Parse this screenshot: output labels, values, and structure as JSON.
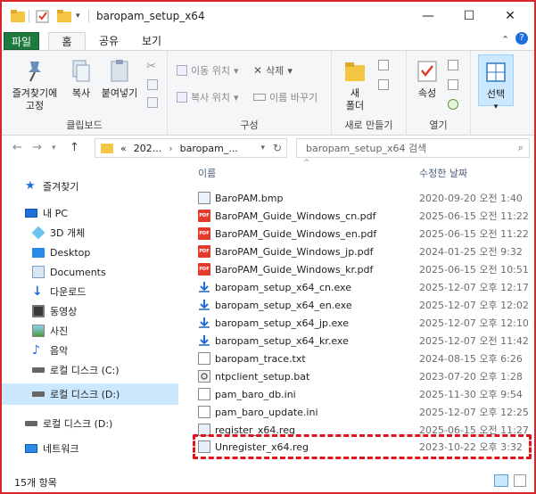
{
  "window": {
    "title": "baropam_setup_x64",
    "minimize_glyph": "—",
    "maximize_glyph": "☐",
    "close_glyph": "✕"
  },
  "ribbon_tabs": [
    "파일",
    "홈",
    "공유",
    "보기"
  ],
  "ribbon": {
    "clipboard": {
      "pin_label": "즐겨찾기에\n고정",
      "copy_label": "복사",
      "paste_label": "붙여넣기",
      "group_label": "클립보드"
    },
    "organize": {
      "move_to": "이동 위치",
      "copy_to": "복사 위치",
      "delete": "삭제",
      "rename": "이름 바꾸기",
      "group_label": "구성"
    },
    "new": {
      "new_folder": "새\n폴더",
      "group_label": "새로 만들기"
    },
    "open": {
      "properties": "속성",
      "group_label": "열기"
    },
    "select": {
      "select_label": "선택"
    }
  },
  "address_bar": {
    "prefix": "«",
    "crumb1": "202...",
    "crumb2": "baropam_...",
    "search_placeholder": "baropam_setup_x64 검색"
  },
  "nav_pane": {
    "items": [
      {
        "label": "즐겨찾기",
        "icon": "star-icon"
      },
      {
        "label": "내 PC",
        "icon": "pc-icon"
      },
      {
        "label": "3D 개체",
        "icon": "3d-objects-icon"
      },
      {
        "label": "Desktop",
        "icon": "desktop-icon"
      },
      {
        "label": "Documents",
        "icon": "documents-icon"
      },
      {
        "label": "다운로드",
        "icon": "download-icon"
      },
      {
        "label": "동영상",
        "icon": "video-icon"
      },
      {
        "label": "사진",
        "icon": "pictures-icon"
      },
      {
        "label": "음악",
        "icon": "music-icon"
      },
      {
        "label": "로컬 디스크 (C:)",
        "icon": "drive-c-icon"
      },
      {
        "label": "로컬 디스크 (D:)",
        "icon": "drive-d-icon"
      },
      {
        "label": "로컬 디스크 (D:)",
        "icon": "drive-d-icon"
      },
      {
        "label": "네트워크",
        "icon": "network-icon"
      }
    ]
  },
  "file_list": {
    "columns": {
      "name": "이름",
      "date": "수정한 날짜"
    },
    "files": [
      {
        "name": "BaroPAM.bmp",
        "date": "2020-09-20 오전 1:40",
        "type": "bmp"
      },
      {
        "name": "BaroPAM_Guide_Windows_cn.pdf",
        "date": "2025-06-15 오전 11:22",
        "type": "pdf"
      },
      {
        "name": "BaroPAM_Guide_Windows_en.pdf",
        "date": "2025-06-15 오전 11:22",
        "type": "pdf"
      },
      {
        "name": "BaroPAM_Guide_Windows_jp.pdf",
        "date": "2024-01-25 오전 9:32",
        "type": "pdf"
      },
      {
        "name": "BaroPAM_Guide_Windows_kr.pdf",
        "date": "2025-06-15 오전 10:51",
        "type": "pdf"
      },
      {
        "name": "baropam_setup_x64_cn.exe",
        "date": "2025-12-07 오후 12:17",
        "type": "exe"
      },
      {
        "name": "baropam_setup_x64_en.exe",
        "date": "2025-12-07 오후 12:02",
        "type": "exe"
      },
      {
        "name": "baropam_setup_x64_jp.exe",
        "date": "2025-12-07 오후 12:10",
        "type": "exe"
      },
      {
        "name": "baropam_setup_x64_kr.exe",
        "date": "2025-12-07 오전 11:42",
        "type": "exe"
      },
      {
        "name": "baropam_trace.txt",
        "date": "2024-08-15 오후 6:26",
        "type": "txt"
      },
      {
        "name": "ntpclient_setup.bat",
        "date": "2023-07-20 오후 1:28",
        "type": "bat"
      },
      {
        "name": "pam_baro_db.ini",
        "date": "2025-11-30 오후 9:54",
        "type": "ini"
      },
      {
        "name": "pam_baro_update.ini",
        "date": "2025-12-07 오후 12:25",
        "type": "ini"
      },
      {
        "name": "register_x64.reg",
        "date": "2025-06-15 오전 11:27",
        "type": "reg"
      },
      {
        "name": "Unregister_x64.reg",
        "date": "2023-10-22 오후 3:32",
        "type": "reg"
      }
    ]
  },
  "status_bar": {
    "item_count": "15개 항목"
  },
  "colors": {
    "file_tab": "#1d7b3e",
    "highlight_dash": "#e0131a",
    "selection": "#cce8ff",
    "window_border": "#d9262c"
  }
}
